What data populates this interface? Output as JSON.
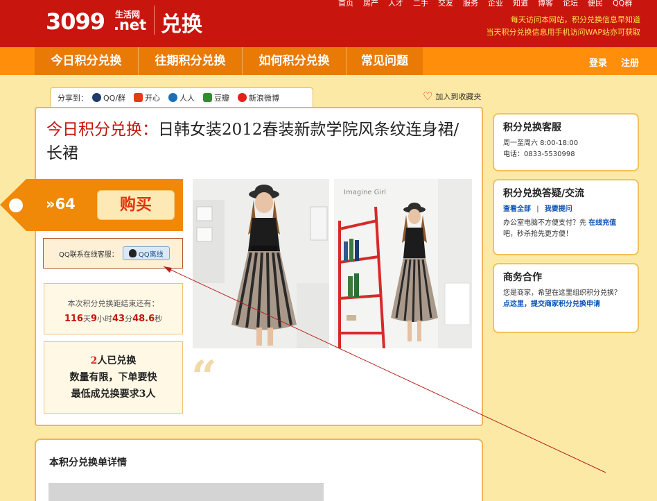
{
  "header": {
    "logo_number": "3099",
    "logo_small": "生活网",
    "logo_net": ".net",
    "logo_title": "兑换",
    "topnav": [
      "首页",
      "房产",
      "人才",
      "二手",
      "交友",
      "服务",
      "企业",
      "知道",
      "博客",
      "论坛",
      "便民",
      "QQ群"
    ],
    "slogan_line1": "每天访问本网站，积分兑换信息早知道",
    "slogan_line2": "当天积分兑换信息用手机访问WAP站亦可获取",
    "colors": {
      "bar": "#c8160f",
      "slogan": "#ffe14f"
    }
  },
  "nav": {
    "tabs": [
      "今日积分兑换",
      "往期积分兑换",
      "如何积分兑换",
      "常见问题"
    ],
    "login": "登录",
    "register": "注册"
  },
  "share": {
    "label": "分享到：",
    "items": [
      {
        "label": "QQ/群",
        "icon": "qq-icon",
        "color": "#1f3a6b"
      },
      {
        "label": "开心",
        "icon": "kaixin-icon",
        "color": "#e43b12"
      },
      {
        "label": "人人",
        "icon": "renren-icon",
        "color": "#1b6fb5"
      },
      {
        "label": "豆瓣",
        "icon": "douban-icon",
        "color": "#2f8f2f"
      },
      {
        "label": "新浪微博",
        "icon": "weibo-icon",
        "color": "#e0231b"
      }
    ],
    "favorite": "加入到收藏夹"
  },
  "deal": {
    "title_prefix": "今日积分兑换：",
    "title": "日韩女装2012春装新款学院风条纹连身裙/长裙",
    "price": "»64",
    "buy_label": "购买",
    "qq_label": "QQ联系在线客服：",
    "qq_button": "QQ离线",
    "time_label": "本次积分兑换距结束还有：",
    "time_days": "116",
    "time_days_unit": "天",
    "time_hours": "9",
    "time_hours_unit": "小时",
    "time_minutes": "43",
    "time_minutes_unit": "分",
    "time_seconds": "48.6",
    "time_seconds_unit": "秒",
    "count_number": "2",
    "count_text": "人已兑换",
    "limit_text": "数量有限，下单要快",
    "min_text": "最低成兑换要求3人",
    "photo2_caption": "Imagine Girl"
  },
  "sidebar": {
    "service": {
      "title": "积分兑换客服",
      "hours": "周一至周六 8:00-18:00",
      "phone": "电话：0833-5530998"
    },
    "faq": {
      "title": "积分兑换答疑/交流",
      "link_all": "查看全部",
      "separator": "|",
      "link_ask": "我要提问",
      "note_before": "办公室电脑不方便支付？先",
      "note_link": "在线充值",
      "note_after": "吧，秒杀抢先更方便！"
    },
    "business": {
      "title": "商务合作",
      "text": "您是商家，希望在这里组织积分兑换？",
      "link": "点这里，提交商家积分兑换申请"
    }
  },
  "detail": {
    "title": "本积分兑换单详情"
  }
}
